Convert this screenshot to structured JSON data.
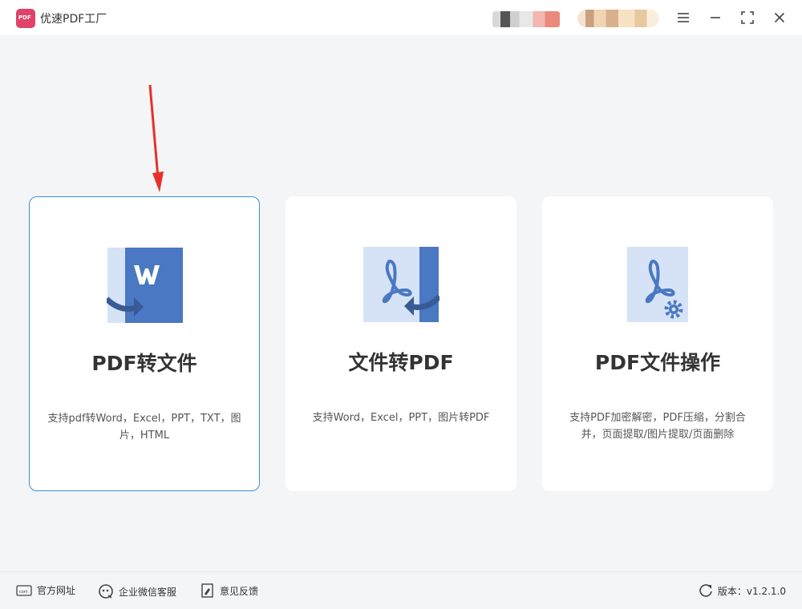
{
  "app": {
    "title": "优速PDF工厂"
  },
  "cards": [
    {
      "title": "PDF转文件",
      "desc": "支持pdf转Word，Excel，PPT，TXT，图片，HTML"
    },
    {
      "title": "文件转PDF",
      "desc": "支持Word，Excel，PPT，图片转PDF"
    },
    {
      "title": "PDF文件操作",
      "desc": "支持PDF加密解密，PDF压缩，分割合并，页面提取/图片提取/页面删除"
    }
  ],
  "footer": {
    "website": "官方网址",
    "wechat": "企业微信客服",
    "feedback": "意见反馈",
    "version": "版本：v1.2.1.0"
  },
  "colors": {
    "accent": "#3b8fd8",
    "icon_dark": "#4a78c2",
    "icon_light": "#d6e2f6",
    "arrow": "#e8302a"
  },
  "icons": [
    "app-logo",
    "menu-icon",
    "minimize-icon",
    "maximize-icon",
    "close-icon",
    "word-file-icon",
    "pdf-file-icon",
    "pdf-settings-icon",
    "website-icon",
    "wechat-icon",
    "feedback-icon",
    "refresh-icon"
  ]
}
